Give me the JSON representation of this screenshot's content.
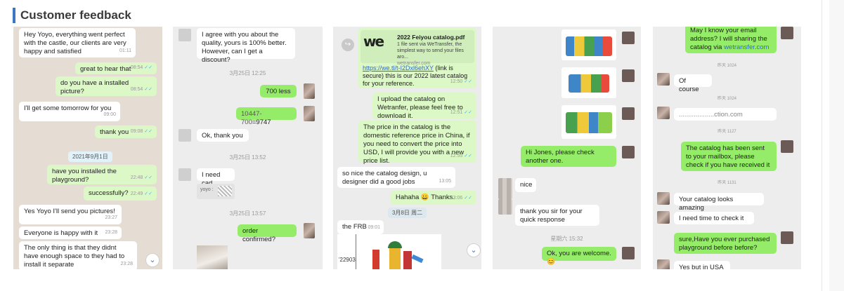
{
  "header": {
    "title": "Customer feedback"
  },
  "panel1": {
    "messages": [
      {
        "text": "Hey Yoyo, everything went perfect with the castle, our clients are very happy and satisfied",
        "time": "01:11"
      },
      {
        "text": "great to hear that",
        "time": "08:54"
      },
      {
        "text": "do you have a installed picture?",
        "time": "08:54"
      },
      {
        "text": "I'll get some tomorrow for you",
        "time": "09:00"
      },
      {
        "text": "thank you",
        "time": "09:08"
      },
      {
        "text": "have you installed the playground?",
        "time": "22:48"
      },
      {
        "text": "successfully?",
        "time": "22:49"
      },
      {
        "text": "Yes Yoyo I'll send you pictures!",
        "time": "23:27"
      },
      {
        "text": "Everyone is happy with it",
        "time": "23:28"
      },
      {
        "text": "The only thing is that they didnt have enough space to they had to install it separate",
        "time": "23:28"
      }
    ],
    "date": "2021年9月1日",
    "scroll_icon": "chevron-down-icon"
  },
  "panel2": {
    "messages": [
      {
        "text": "I agree with you about the quality, yours is 100% better. However, can I get a discount?"
      },
      {
        "text": "700 less"
      },
      {
        "text_prefix": "10447-700",
        "text_suffix": "=9747"
      },
      {
        "text": "Ok, thank you"
      },
      {
        "text": "I need cad"
      },
      {
        "text": "order confirmed?"
      }
    ],
    "times": [
      "3月25日 12:25",
      "3月25日 13:52",
      "3月25日 13:57"
    ],
    "quote_label": "yoyo :"
  },
  "panel3": {
    "card": {
      "title": "2022 Feiyou catalog.pdf",
      "desc": "1 file sent via WeTransfer, the simplest way to send your files aro...",
      "site": "wetransfer.com",
      "logo": "we"
    },
    "link": "https://we.tl/t-I2Dxl6ehXY",
    "link_after": "(link is secure)  this is our 2022 latest catalog for your reference.",
    "t1": "12:50",
    "m2": "I upload the catalog on Wetranfer, please feel free to download it.",
    "t2": "12:51",
    "m3": "The price in the catalog is the domestic reference price in China, if you need to convert the price into USD,  I will provide you with a new price list.",
    "t3": "12:55",
    "m4": "so nice the catalog design, u designer did a good jobs",
    "t4": "13:05",
    "m5": "Hahaha 😀 Thanks.",
    "t5": "13:06",
    "date": "3月8日 周二",
    "m6": "the FRB",
    "t6": "09:01",
    "snippet": "'22903"
  },
  "panel4": {
    "m1": "Hi Jones, please check another one.",
    "m2": "nice",
    "m3": "thank you sir for your quick response",
    "time": "星期六 15:32",
    "m4": "Ok, you are welcome.😊"
  },
  "panel5": {
    "m1a": "May I know your email address? I will sharing the catalog via ",
    "m1b": "wetransfer.com",
    "t1": "昨天 1024",
    "m2": "Of course",
    "t2": "昨天 1024",
    "m3": "...................ction.com",
    "t3": "昨天 1127",
    "m4": "The catalog has been sent to your mailbox, please check if you have received it",
    "t4": "昨天 1131",
    "m5": "Your catalog looks amazing",
    "m6": "I need time to check it",
    "m7": "sure,Have you ever purchased playground before before?",
    "m8": "Yes but in USA"
  }
}
